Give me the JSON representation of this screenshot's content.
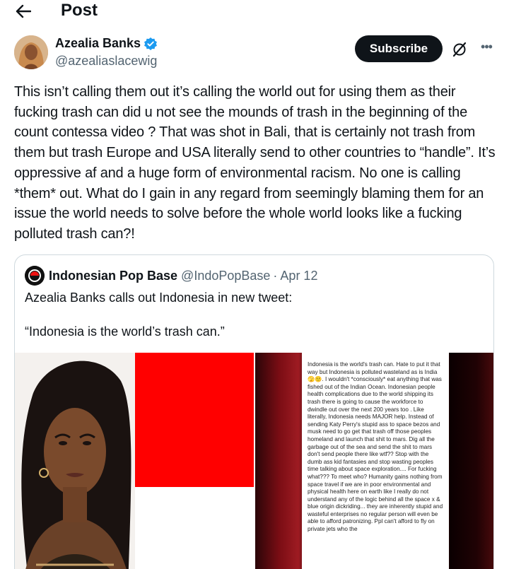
{
  "header": {
    "title": "Post"
  },
  "author": {
    "name": "Azealia Banks",
    "handle": "@azealiaslacewig"
  },
  "actions": {
    "subscribe_label": "Subscribe",
    "more_label": "•••"
  },
  "post": {
    "text": "This isn’t calling them out it’s calling the world out for using them as their fucking trash can did u not see the mounds of trash in the beginning of the count contessa video ? That was shot in Bali, that is certainly not trash from them but trash Europe and USA literally send to other countries to “handle”. It’s oppressive af and a huge form of environmental racism. No one is calling *them* out. What do I gain in any regard from seemingly blaming them for an issue the world needs to solve before the whole world looks like a fucking polluted trash can?!"
  },
  "quote": {
    "name": "Indonesian Pop Base",
    "handle": "@IndoPopBase",
    "separator": "·",
    "date": "Apr 12",
    "line1": "Azealia Banks calls out Indonesia in new tweet:",
    "line2": "“Indonesia is the world’s trash can.”",
    "screenshot_text": "Indonesia is the world's trash can. Hate to put it that way but Indonesia is polluted wasteland as is India 🫣🙂. I wouldn't *consciously* eat anything that was fished out of the Indian Ocean. Indonesian people health complications due to the world shipping its trash there is going to cause the workforce to dwindle out over the next 200 years too . Like literally, Indonesia needs MAJOR help. Instead of sending Katy Perry's stupid ass to space bezos and musk need to go get that trash off those peoples homeland and launch that shit to mars. Dig all the garbage out of the sea and send the shit to mars don't send people there like wtf?? Stop with the dumb ass kid fantasies and stop wasting peoples time talking about space exploration.... For fucking what??? To meet who? Humanity gains nothing from space travel if we are in poor environmental and physical health here on earth like I really do not understand any of the logic behind all the space x & blue origin dickriding... they are inherently stupid and wasteful enterprises no regular person will even be able to afford patronizing. Ppl can't afford to fly on private jets who the"
  },
  "colors": {
    "accent": "#1d9bf0",
    "text": "#0f1419",
    "muted": "#536471",
    "border": "#cfd9de",
    "flag_red": "#ff0000"
  }
}
